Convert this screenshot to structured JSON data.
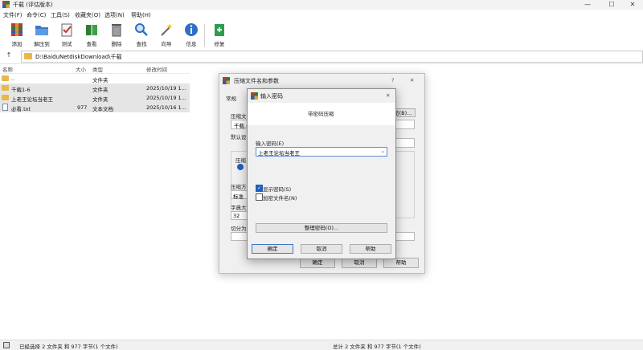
{
  "window": {
    "title": "千载 (评估版本)",
    "btn_min": "—",
    "btn_max": "☐",
    "btn_close": "✕"
  },
  "menu": [
    "文件(F)",
    "命令(C)",
    "工具(S)",
    "收藏夹(O)",
    "选项(N)",
    "帮助(H)"
  ],
  "toolbar": [
    {
      "label": "添加",
      "icon": "add-archive-icon",
      "color": "#c0392b"
    },
    {
      "label": "解压到",
      "icon": "extract-folder-icon",
      "color": "#3a78c8"
    },
    {
      "label": "测试",
      "icon": "test-icon",
      "color": "#c0392b"
    },
    {
      "label": "查看",
      "icon": "view-book-icon",
      "color": "#2e7d32"
    },
    {
      "label": "删除",
      "icon": "delete-icon",
      "color": "#8a8f96"
    },
    {
      "label": "查找",
      "icon": "find-icon",
      "color": "#2f6fc5"
    },
    {
      "label": "向导",
      "icon": "wizard-icon",
      "color": "#8e8e8e"
    },
    {
      "label": "信息",
      "icon": "info-icon",
      "color": "#2f6fc5"
    },
    {
      "label": "修复",
      "icon": "repair-icon",
      "color": "#2e9e4c"
    }
  ],
  "address": {
    "up": "↑",
    "path": "D:\\BaiduNetdiskDownload\\千载"
  },
  "list": {
    "headers": [
      "名称",
      "大小",
      "类型",
      "修改时间"
    ],
    "rows": [
      {
        "name": "..",
        "size": "",
        "type": "文件夹",
        "mtime": "",
        "kind": "folder",
        "selected": false
      },
      {
        "name": "千载1-6",
        "size": "",
        "type": "文件夹",
        "mtime": "2025/10/19 1...",
        "kind": "folder",
        "selected": true
      },
      {
        "name": "上老王论坛当老王",
        "size": "",
        "type": "文件夹",
        "mtime": "2025/10/19 1...",
        "kind": "folder",
        "selected": true
      },
      {
        "name": "必看.txt",
        "size": "977",
        "type": "文本文档",
        "mtime": "2025/10/16 1...",
        "kind": "txt",
        "selected": true
      }
    ]
  },
  "status": {
    "left": "已经选择 2 文件夹 和 977 字节(1 个文件)",
    "right": "总计 2 文件夹 和 977 字节(1 个文件)"
  },
  "archive_dialog": {
    "title": "压缩文件名和参数",
    "help": "?",
    "close": "✕",
    "tab_general": "常规",
    "label_archive": "压缩文",
    "archive_value": "千载.r",
    "browse": "浏览(B)...",
    "label_profile": "默认设",
    "label_format": "压缩",
    "label_method": "压缩方",
    "method_value": "标准",
    "label_dict": "字典大",
    "dict_value": "32",
    "label_split": "切分为",
    "ok": "确定",
    "cancel": "取消",
    "help_btn": "帮助"
  },
  "password_dialog": {
    "title": "输入密码",
    "close": "✕",
    "subtitle": "带密码压缩",
    "label_pw": "输入密码(E)",
    "pw_value": "上老王论坛当老王",
    "show_pw": "显示密码(S)",
    "show_pw_checked": true,
    "encrypt_names": "加密文件名(N)",
    "encrypt_names_checked": false,
    "manage": "整理密码(O)...",
    "ok": "确定",
    "cancel": "取消",
    "help": "帮助"
  }
}
